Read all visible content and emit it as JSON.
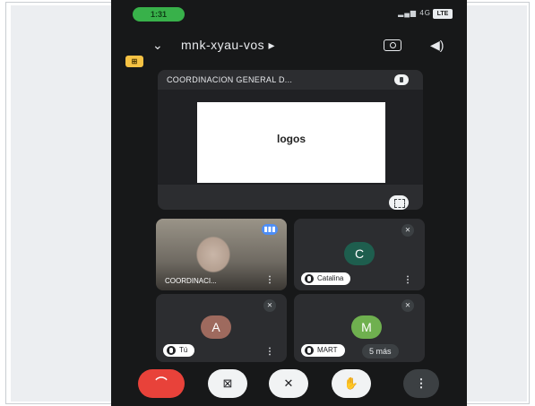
{
  "status": {
    "time": "1:31",
    "network": "4G",
    "battery": "LTE"
  },
  "meeting": {
    "code": "mnk-xyau-vos",
    "code_arrow": "▸"
  },
  "badge": "⊞",
  "presentation": {
    "title": "COORDINACION GENERAL D...",
    "slide_text": "logos"
  },
  "tiles": [
    {
      "name": "COORDINACI...",
      "more": "⋮"
    },
    {
      "name": "Catalina",
      "avatar": "C",
      "more": "⋮"
    },
    {
      "name": "Tú",
      "avatar": "A",
      "more": "⋮"
    },
    {
      "name": "MART",
      "avatar": "M",
      "more_label": "5 más"
    }
  ],
  "controls": {
    "more": "⋮"
  }
}
